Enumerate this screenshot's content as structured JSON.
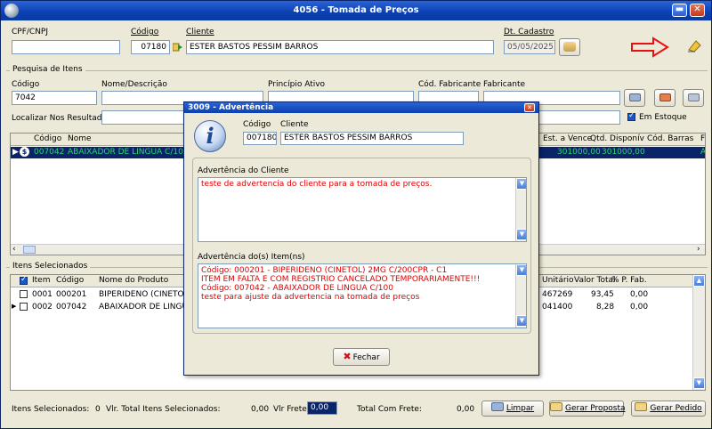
{
  "window": {
    "title": "4056 - Tomada de Preços"
  },
  "header": {
    "cpf_label": "CPF/CNPJ",
    "cpf_value": "",
    "codigo_label": "Código",
    "codigo_value": "07180",
    "cliente_label": "Cliente",
    "cliente_value": "ESTER BASTOS PESSIM BARROS",
    "dt_cadastro_label": "Dt. Cadastro",
    "dt_cadastro_value": "05/05/2025"
  },
  "pesquisa": {
    "group_label": "Pesquisa de Itens",
    "codigo_label": "Código",
    "codigo_value": "7042",
    "nome_label": "Nome/Descrição",
    "principio_label": "Princípio Ativo",
    "cod_fabricante_label": "Cód. Fabricante",
    "fabricante_label": "Fabricante",
    "localizar_label": "Localizar Nos Resultados",
    "em_estoque_label": "Em Estoque"
  },
  "results_grid": {
    "headers": {
      "codigo": "Código",
      "nome": "Nome",
      "est_vence": "Est. a Vence",
      "qtd_disp": "Qtd. Disponív",
      "cod_barras": "Cód. Barras",
      "f": "F"
    },
    "rows": [
      {
        "codigo": "007042",
        "nome": "ABAIXADOR DE LINGUA C/100",
        "est_vence": "301000,00",
        "qtd_disp": "301000,00",
        "f": "A"
      }
    ]
  },
  "selected": {
    "group_label": "Itens Selecionados",
    "headers": {
      "item": "Item",
      "codigo": "Código",
      "nome": "Nome do Produto",
      "unitario": "Unitário",
      "valor_total": "Valor Total",
      "p_fab": "% P. Fab."
    },
    "rows": [
      {
        "item": "0001",
        "codigo": "000201",
        "nome": "BIPERIDENO (CINETO",
        "unitario": "467269",
        "valor_total": "93,45",
        "p_fab": "0,00"
      },
      {
        "item": "0002",
        "codigo": "007042",
        "nome": "ABAIXADOR DE LINGU",
        "unitario": "041400",
        "valor_total": "8,28",
        "p_fab": "0,00"
      }
    ]
  },
  "dialog": {
    "title": "3009 - Advertência",
    "codigo_label": "Código",
    "codigo_value": "007180",
    "cliente_label": "Cliente",
    "cliente_value": "ESTER BASTOS PESSIM BARROS",
    "adv_cliente_label": "Advertência do Cliente",
    "adv_cliente_lines": [
      "teste de advertencia do cliente para a tomada de preços."
    ],
    "adv_itens_label": "Advertência do(s) Item(ns)",
    "adv_itens_lines": [
      "Código: 000201 - BIPERIDENO (CINETOL) 2MG C/200CPR - C1",
      "ITEM EM FALTA E COM REGISTRIO CANCELADO TEMPORARIAMENTE!!!",
      "Código: 007042 - ABAIXADOR DE LINGUA C/100",
      "teste para ajuste da advertencia na tomada de preços"
    ],
    "fechar_label": "Fechar"
  },
  "footer": {
    "itens_sel_label": "Itens Selecionados:",
    "itens_sel_value": "0",
    "vlr_total_label": "Vlr. Total Itens Selecionados:",
    "vlr_total_value": "0,00",
    "vlr_frete_label": "Vlr Frete:",
    "vlr_frete_value": "0,00",
    "total_frete_label": "Total Com Frete:",
    "total_frete_value": "0,00",
    "limpar_label": "Limpar",
    "gerar_proposta_label": "Gerar Proposta",
    "gerar_pedido_label": "Gerar Pedido"
  },
  "colors": {
    "selection_row": "#0a246a",
    "highlight_text": "#31d46b",
    "warning_text": "#e00000",
    "arrow": "#e81010"
  }
}
